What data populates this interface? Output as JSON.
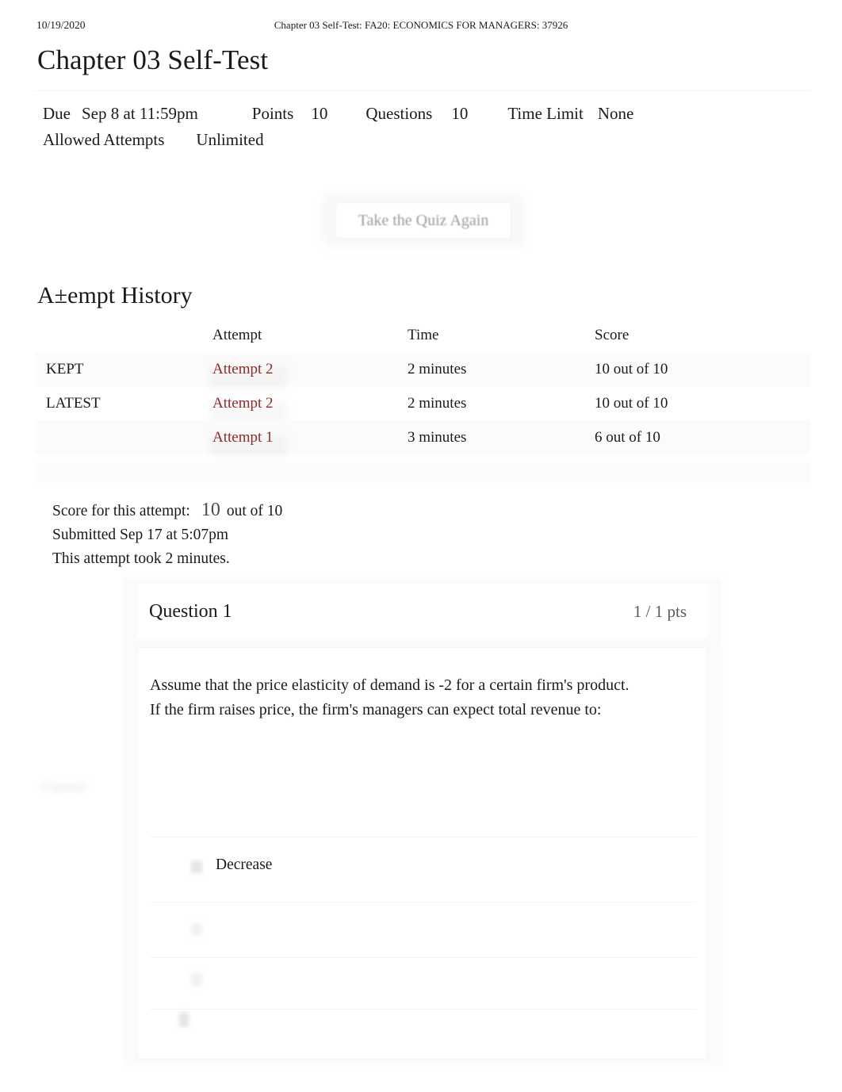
{
  "print_header": {
    "date": "10/19/2020",
    "document_title": "Chapter 03 Self-Test: FA20: ECONOMICS FOR MANAGERS: 37926"
  },
  "page": {
    "title": "Chapter 03 Self-Test"
  },
  "quiz_meta": {
    "due_label": "Due",
    "due_value": "Sep 8 at 11:59pm",
    "points_label": "Points",
    "points_value": "10",
    "questions_label": "Questions",
    "questions_value": "10",
    "time_limit_label": "Time Limit",
    "time_limit_value": "None",
    "allowed_attempts_label": "Allowed Attempts",
    "allowed_attempts_value": "Unlimited"
  },
  "actions": {
    "retake_label": "Take the Quiz Again"
  },
  "attempt_history": {
    "heading": "A±empt History",
    "columns": {
      "flag": "",
      "attempt": "Attempt",
      "time": "Time",
      "score": "Score"
    },
    "rows": [
      {
        "flag": "KEPT",
        "attempt": "Attempt 2",
        "time": "2 minutes",
        "score": "10 out of 10"
      },
      {
        "flag": "LATEST",
        "attempt": "Attempt 2",
        "time": "2 minutes",
        "score": "10 out of 10"
      },
      {
        "flag": "",
        "attempt": "Attempt 1",
        "time": "3 minutes",
        "score": "6 out of 10"
      }
    ],
    "link_color": "#8f2424"
  },
  "attempt_summary": {
    "score_label": "Score for this attempt:",
    "score_value": "10",
    "score_suffix": "out of 10",
    "submitted": "Submitted Sep 17 at 5:07pm",
    "duration": "This attempt took 2 minutes."
  },
  "question": {
    "title": "Question 1",
    "points": "1 / 1 pts",
    "prompt": "Assume that the price elasticity of demand is -2 for a certain firm's product. If the firm raises price, the firm's managers can expect total revenue to:",
    "correct_badge": "Correct",
    "options": [
      {
        "label": "Decrease",
        "visible": true
      },
      {
        "label": "",
        "visible": false
      },
      {
        "label": "",
        "visible": false
      }
    ],
    "explanation": ""
  }
}
